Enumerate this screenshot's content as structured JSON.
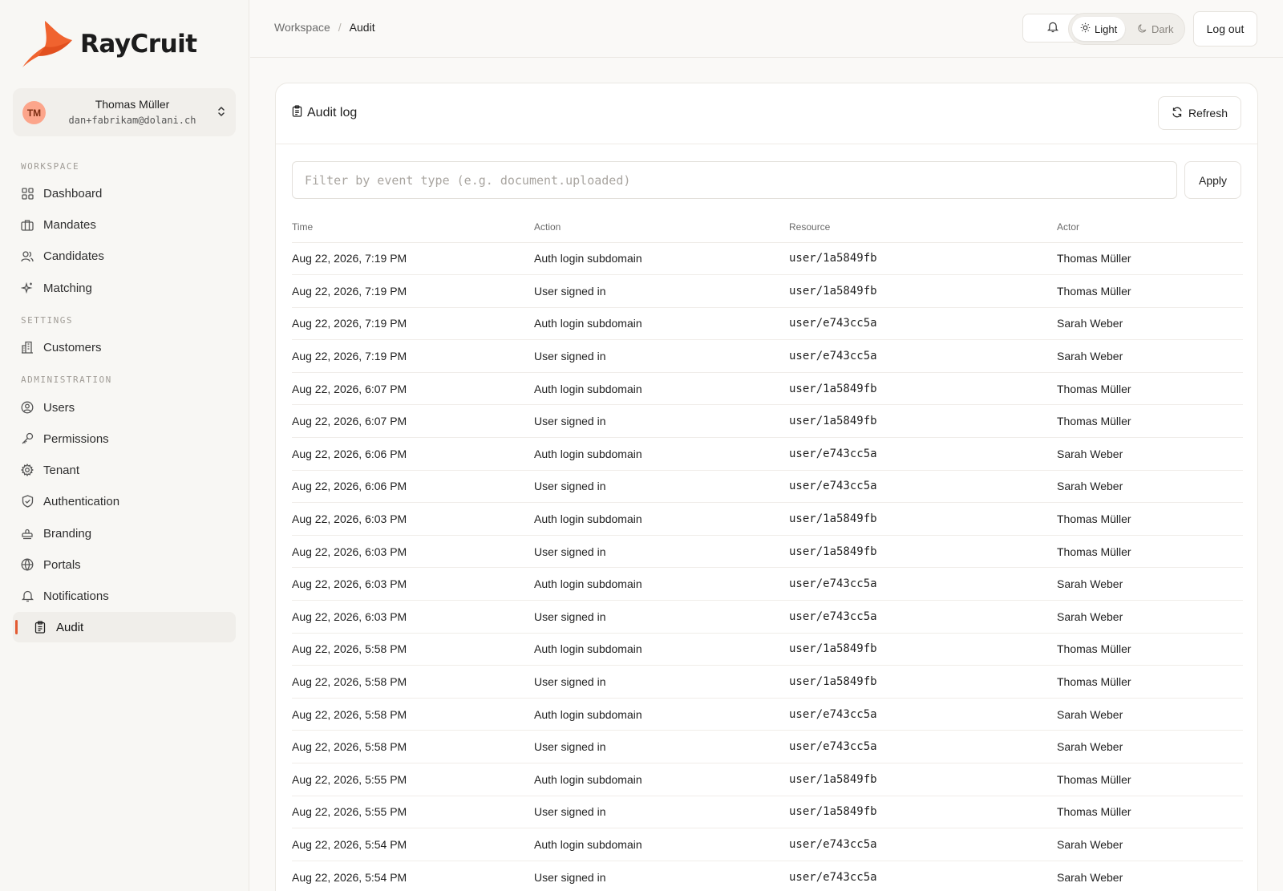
{
  "app": {
    "brand": "RayCruit",
    "brand_color": "#f0632f"
  },
  "user": {
    "initials": "TM",
    "name": "Thomas Müller",
    "email": "dan+fabrikam@dolani.ch"
  },
  "sidebar": {
    "sections": {
      "workspace": "WORKSPACE",
      "settings": "SETTINGS",
      "administration": "ADMINISTRATION"
    },
    "items": {
      "dashboard": "Dashboard",
      "mandates": "Mandates",
      "candidates": "Candidates",
      "matching": "Matching",
      "customers": "Customers",
      "users": "Users",
      "permissions": "Permissions",
      "tenant": "Tenant",
      "authentication": "Authentication",
      "branding": "Branding",
      "portals": "Portals",
      "notifications": "Notifications",
      "audit": "Audit"
    },
    "active_item": "Audit",
    "active_color": "#e35b33"
  },
  "header": {
    "breadcrumb": [
      "Workspace",
      "Audit"
    ],
    "theme": {
      "light": "Light",
      "dark": "Dark",
      "selected": "Light"
    },
    "logout_label": "Log out"
  },
  "audit": {
    "title": "Audit log",
    "refresh_label": "Refresh",
    "filter_placeholder": "Filter by event type (e.g. document.uploaded)",
    "filter_value": "",
    "apply_label": "Apply",
    "columns": [
      "Time",
      "Action",
      "Resource",
      "Actor"
    ],
    "rows": [
      {
        "time": "Aug 22, 2026, 7:19 PM",
        "action": "Auth login subdomain",
        "resource": "user/1a5849fb",
        "actor": "Thomas Müller"
      },
      {
        "time": "Aug 22, 2026, 7:19 PM",
        "action": "User signed in",
        "resource": "user/1a5849fb",
        "actor": "Thomas Müller"
      },
      {
        "time": "Aug 22, 2026, 7:19 PM",
        "action": "Auth login subdomain",
        "resource": "user/e743cc5a",
        "actor": "Sarah Weber"
      },
      {
        "time": "Aug 22, 2026, 7:19 PM",
        "action": "User signed in",
        "resource": "user/e743cc5a",
        "actor": "Sarah Weber"
      },
      {
        "time": "Aug 22, 2026, 6:07 PM",
        "action": "Auth login subdomain",
        "resource": "user/1a5849fb",
        "actor": "Thomas Müller"
      },
      {
        "time": "Aug 22, 2026, 6:07 PM",
        "action": "User signed in",
        "resource": "user/1a5849fb",
        "actor": "Thomas Müller"
      },
      {
        "time": "Aug 22, 2026, 6:06 PM",
        "action": "Auth login subdomain",
        "resource": "user/e743cc5a",
        "actor": "Sarah Weber"
      },
      {
        "time": "Aug 22, 2026, 6:06 PM",
        "action": "User signed in",
        "resource": "user/e743cc5a",
        "actor": "Sarah Weber"
      },
      {
        "time": "Aug 22, 2026, 6:03 PM",
        "action": "Auth login subdomain",
        "resource": "user/1a5849fb",
        "actor": "Thomas Müller"
      },
      {
        "time": "Aug 22, 2026, 6:03 PM",
        "action": "User signed in",
        "resource": "user/1a5849fb",
        "actor": "Thomas Müller"
      },
      {
        "time": "Aug 22, 2026, 6:03 PM",
        "action": "Auth login subdomain",
        "resource": "user/e743cc5a",
        "actor": "Sarah Weber"
      },
      {
        "time": "Aug 22, 2026, 6:03 PM",
        "action": "User signed in",
        "resource": "user/e743cc5a",
        "actor": "Sarah Weber"
      },
      {
        "time": "Aug 22, 2026, 5:58 PM",
        "action": "Auth login subdomain",
        "resource": "user/1a5849fb",
        "actor": "Thomas Müller"
      },
      {
        "time": "Aug 22, 2026, 5:58 PM",
        "action": "User signed in",
        "resource": "user/1a5849fb",
        "actor": "Thomas Müller"
      },
      {
        "time": "Aug 22, 2026, 5:58 PM",
        "action": "Auth login subdomain",
        "resource": "user/e743cc5a",
        "actor": "Sarah Weber"
      },
      {
        "time": "Aug 22, 2026, 5:58 PM",
        "action": "User signed in",
        "resource": "user/e743cc5a",
        "actor": "Sarah Weber"
      },
      {
        "time": "Aug 22, 2026, 5:55 PM",
        "action": "Auth login subdomain",
        "resource": "user/1a5849fb",
        "actor": "Thomas Müller"
      },
      {
        "time": "Aug 22, 2026, 5:55 PM",
        "action": "User signed in",
        "resource": "user/1a5849fb",
        "actor": "Thomas Müller"
      },
      {
        "time": "Aug 22, 2026, 5:54 PM",
        "action": "Auth login subdomain",
        "resource": "user/e743cc5a",
        "actor": "Sarah Weber"
      },
      {
        "time": "Aug 22, 2026, 5:54 PM",
        "action": "User signed in",
        "resource": "user/e743cc5a",
        "actor": "Sarah Weber"
      }
    ]
  },
  "icons": {
    "logo": "raycruit-bird-logo",
    "user_chevron": "chevron-up-down-icon",
    "bell": "bell-icon",
    "light": "sun-icon",
    "dark": "moon-icon",
    "audit_title": "clipboard-icon",
    "refresh": "refresh-icon"
  }
}
